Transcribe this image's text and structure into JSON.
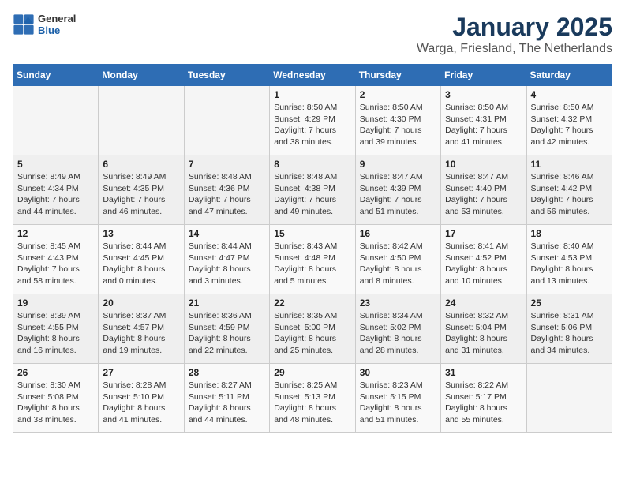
{
  "logo": {
    "general": "General",
    "blue": "Blue"
  },
  "header": {
    "month": "January 2025",
    "location": "Warga, Friesland, The Netherlands"
  },
  "weekdays": [
    "Sunday",
    "Monday",
    "Tuesday",
    "Wednesday",
    "Thursday",
    "Friday",
    "Saturday"
  ],
  "weeks": [
    [
      {
        "day": "",
        "info": ""
      },
      {
        "day": "",
        "info": ""
      },
      {
        "day": "",
        "info": ""
      },
      {
        "day": "1",
        "info": "Sunrise: 8:50 AM\nSunset: 4:29 PM\nDaylight: 7 hours and 38 minutes."
      },
      {
        "day": "2",
        "info": "Sunrise: 8:50 AM\nSunset: 4:30 PM\nDaylight: 7 hours and 39 minutes."
      },
      {
        "day": "3",
        "info": "Sunrise: 8:50 AM\nSunset: 4:31 PM\nDaylight: 7 hours and 41 minutes."
      },
      {
        "day": "4",
        "info": "Sunrise: 8:50 AM\nSunset: 4:32 PM\nDaylight: 7 hours and 42 minutes."
      }
    ],
    [
      {
        "day": "5",
        "info": "Sunrise: 8:49 AM\nSunset: 4:34 PM\nDaylight: 7 hours and 44 minutes."
      },
      {
        "day": "6",
        "info": "Sunrise: 8:49 AM\nSunset: 4:35 PM\nDaylight: 7 hours and 46 minutes."
      },
      {
        "day": "7",
        "info": "Sunrise: 8:48 AM\nSunset: 4:36 PM\nDaylight: 7 hours and 47 minutes."
      },
      {
        "day": "8",
        "info": "Sunrise: 8:48 AM\nSunset: 4:38 PM\nDaylight: 7 hours and 49 minutes."
      },
      {
        "day": "9",
        "info": "Sunrise: 8:47 AM\nSunset: 4:39 PM\nDaylight: 7 hours and 51 minutes."
      },
      {
        "day": "10",
        "info": "Sunrise: 8:47 AM\nSunset: 4:40 PM\nDaylight: 7 hours and 53 minutes."
      },
      {
        "day": "11",
        "info": "Sunrise: 8:46 AM\nSunset: 4:42 PM\nDaylight: 7 hours and 56 minutes."
      }
    ],
    [
      {
        "day": "12",
        "info": "Sunrise: 8:45 AM\nSunset: 4:43 PM\nDaylight: 7 hours and 58 minutes."
      },
      {
        "day": "13",
        "info": "Sunrise: 8:44 AM\nSunset: 4:45 PM\nDaylight: 8 hours and 0 minutes."
      },
      {
        "day": "14",
        "info": "Sunrise: 8:44 AM\nSunset: 4:47 PM\nDaylight: 8 hours and 3 minutes."
      },
      {
        "day": "15",
        "info": "Sunrise: 8:43 AM\nSunset: 4:48 PM\nDaylight: 8 hours and 5 minutes."
      },
      {
        "day": "16",
        "info": "Sunrise: 8:42 AM\nSunset: 4:50 PM\nDaylight: 8 hours and 8 minutes."
      },
      {
        "day": "17",
        "info": "Sunrise: 8:41 AM\nSunset: 4:52 PM\nDaylight: 8 hours and 10 minutes."
      },
      {
        "day": "18",
        "info": "Sunrise: 8:40 AM\nSunset: 4:53 PM\nDaylight: 8 hours and 13 minutes."
      }
    ],
    [
      {
        "day": "19",
        "info": "Sunrise: 8:39 AM\nSunset: 4:55 PM\nDaylight: 8 hours and 16 minutes."
      },
      {
        "day": "20",
        "info": "Sunrise: 8:37 AM\nSunset: 4:57 PM\nDaylight: 8 hours and 19 minutes."
      },
      {
        "day": "21",
        "info": "Sunrise: 8:36 AM\nSunset: 4:59 PM\nDaylight: 8 hours and 22 minutes."
      },
      {
        "day": "22",
        "info": "Sunrise: 8:35 AM\nSunset: 5:00 PM\nDaylight: 8 hours and 25 minutes."
      },
      {
        "day": "23",
        "info": "Sunrise: 8:34 AM\nSunset: 5:02 PM\nDaylight: 8 hours and 28 minutes."
      },
      {
        "day": "24",
        "info": "Sunrise: 8:32 AM\nSunset: 5:04 PM\nDaylight: 8 hours and 31 minutes."
      },
      {
        "day": "25",
        "info": "Sunrise: 8:31 AM\nSunset: 5:06 PM\nDaylight: 8 hours and 34 minutes."
      }
    ],
    [
      {
        "day": "26",
        "info": "Sunrise: 8:30 AM\nSunset: 5:08 PM\nDaylight: 8 hours and 38 minutes."
      },
      {
        "day": "27",
        "info": "Sunrise: 8:28 AM\nSunset: 5:10 PM\nDaylight: 8 hours and 41 minutes."
      },
      {
        "day": "28",
        "info": "Sunrise: 8:27 AM\nSunset: 5:11 PM\nDaylight: 8 hours and 44 minutes."
      },
      {
        "day": "29",
        "info": "Sunrise: 8:25 AM\nSunset: 5:13 PM\nDaylight: 8 hours and 48 minutes."
      },
      {
        "day": "30",
        "info": "Sunrise: 8:23 AM\nSunset: 5:15 PM\nDaylight: 8 hours and 51 minutes."
      },
      {
        "day": "31",
        "info": "Sunrise: 8:22 AM\nSunset: 5:17 PM\nDaylight: 8 hours and 55 minutes."
      },
      {
        "day": "",
        "info": ""
      }
    ]
  ]
}
